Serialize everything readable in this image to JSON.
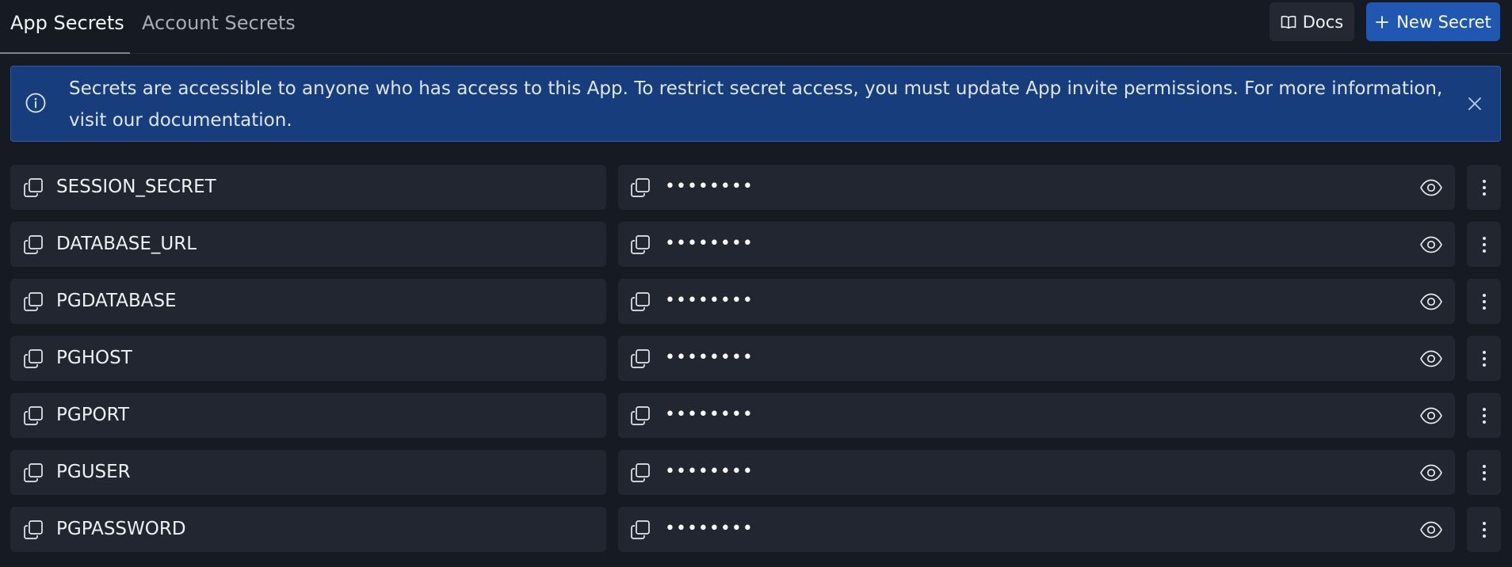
{
  "tabs": {
    "app": "App Secrets",
    "account": "Account Secrets"
  },
  "header": {
    "docs_label": "Docs",
    "new_secret_label": "New Secret"
  },
  "banner": {
    "text": "Secrets are accessible to anyone who has access to this App. To restrict secret access, you must update App invite permissions. For more information, visit our documentation."
  },
  "secrets": [
    {
      "key": "SESSION_SECRET",
      "masked": "••••••••"
    },
    {
      "key": "DATABASE_URL",
      "masked": "••••••••"
    },
    {
      "key": "PGDATABASE",
      "masked": "••••••••"
    },
    {
      "key": "PGHOST",
      "masked": "••••••••"
    },
    {
      "key": "PGPORT",
      "masked": "••••••••"
    },
    {
      "key": "PGUSER",
      "masked": "••••••••"
    },
    {
      "key": "PGPASSWORD",
      "masked": "••••••••"
    }
  ],
  "icons": {
    "info": "info-icon",
    "close": "close-icon",
    "docs": "book-icon",
    "new": "plus-icon",
    "copy": "copy-icon",
    "reveal": "eye-icon",
    "menu": "more-vertical-icon"
  },
  "colors": {
    "background": "#161a22",
    "row_background": "#222630",
    "banner_background": "#173d7c",
    "primary_button": "#1f57b3"
  }
}
